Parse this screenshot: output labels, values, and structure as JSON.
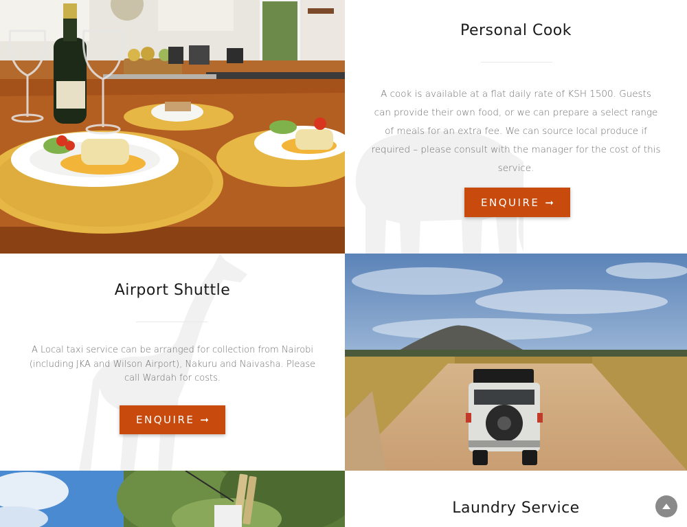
{
  "personal_cook": {
    "title": "Personal Cook",
    "description": "A cook is available at a flat daily rate of KSH 1500. Guests can provide their own food, or we can prepare a select range of meals for an extra fee. We can source local produce if required – please consult with the manager for the cost of this service.",
    "button_label": "ENQUIRE",
    "button_icon": "long-arrow-right-icon"
  },
  "airport_shuttle": {
    "title": "Airport Shuttle",
    "description": "A Local taxi service can be arranged for collection from Nairobi (including JKA and Wilson Airport), Nakuru and Naivasha. Please call Wardah for costs.",
    "button_label": "ENQUIRE",
    "button_icon": "long-arrow-right-icon"
  },
  "laundry_service": {
    "title": "Laundry Service"
  },
  "images": {
    "kitchen": "kitchen-dining-photo",
    "safari": "safari-vehicle-dirt-road-photo",
    "laundry": "clothesline-peg-photo"
  },
  "scroll_top_icon": "chevron-up-icon",
  "colors": {
    "accent": "#c94a0d",
    "title": "#1a1a1a",
    "body_text": "#6d6d6d",
    "silhouette": "#f1f1f1",
    "scroll_top": "#8a8a8a"
  }
}
